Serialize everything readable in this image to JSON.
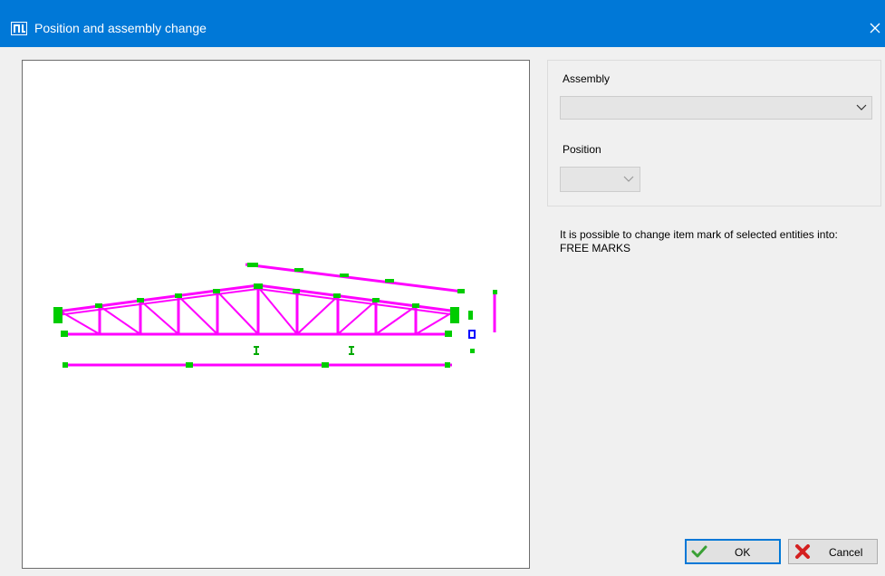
{
  "window": {
    "title": "Position and assembly change",
    "app_icon": "structure-app-icon",
    "close_icon": "close-icon",
    "accent_color": "#0078d7"
  },
  "preview": {
    "icon": "truss-drawing-preview",
    "colors": {
      "members": "#ff00ff",
      "plates": "#00cc00",
      "sections": "#0000ff"
    }
  },
  "assembly": {
    "label": "Assembly",
    "value": "",
    "icon": "chevron-down-icon"
  },
  "position": {
    "label": "Position",
    "value": "",
    "icon": "chevron-down-icon"
  },
  "info": {
    "line1": "It is possible to change item mark of selected entities into:",
    "line2": "FREE MARKS"
  },
  "buttons": {
    "ok_label": "OK",
    "ok_icon": "check-icon",
    "cancel_label": "Cancel",
    "cancel_icon": "red-x-icon"
  }
}
